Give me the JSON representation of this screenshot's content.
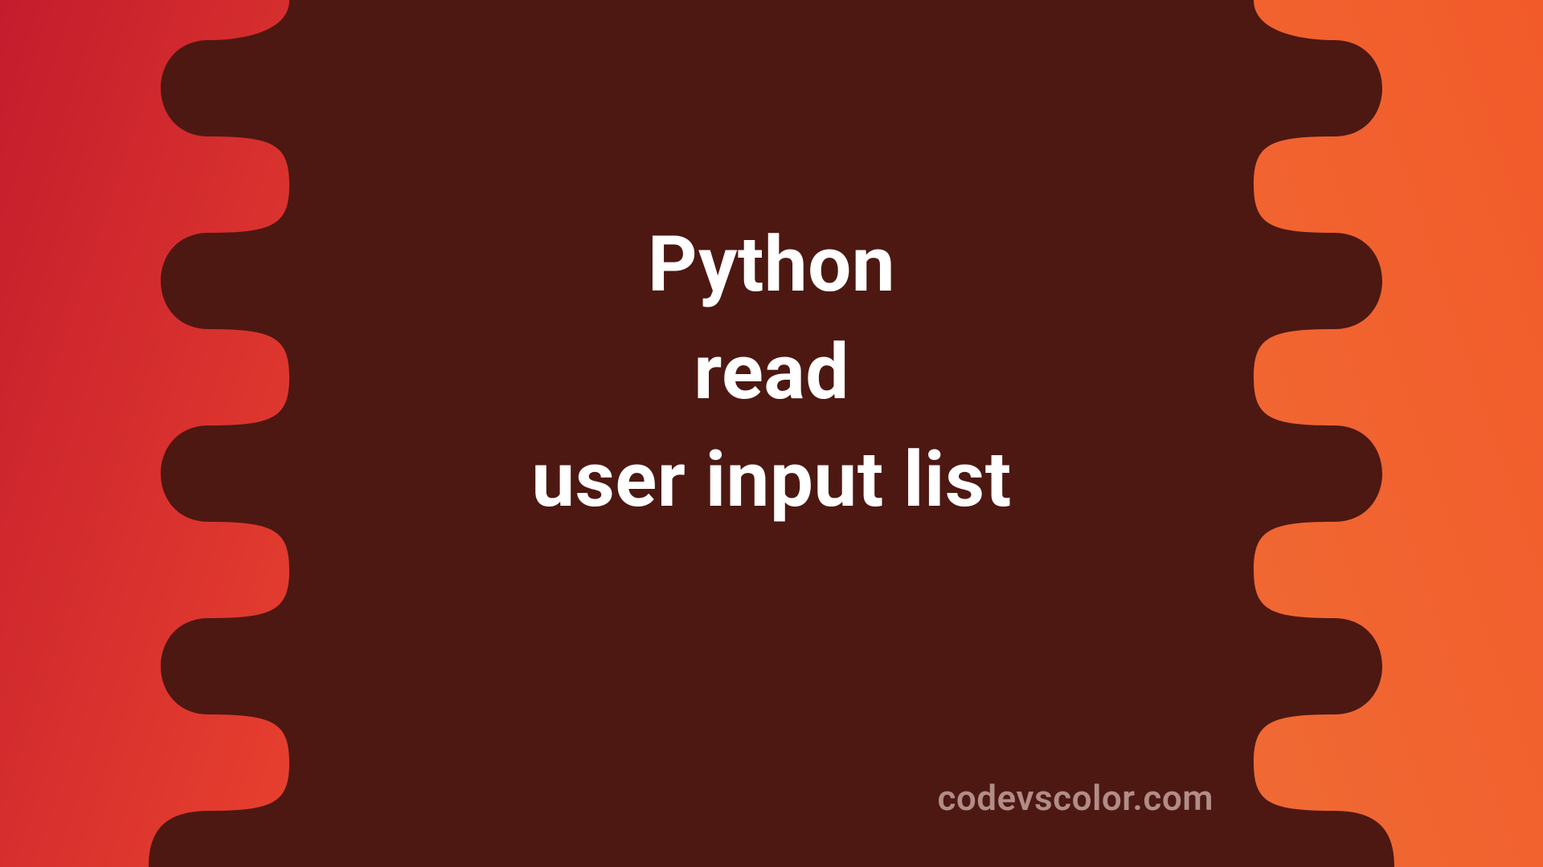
{
  "title": {
    "line1": "Python",
    "line2": "read",
    "line3": "user input list"
  },
  "watermark": "codevscolor.com",
  "colors": {
    "bg": "#4d1812",
    "left_grad_a": "#c41c2d",
    "left_grad_b": "#e8412e",
    "right_grad_a": "#f25a2a",
    "right_grad_b": "#f06a34",
    "text": "#ffffff",
    "watermark": "#b28c87"
  }
}
